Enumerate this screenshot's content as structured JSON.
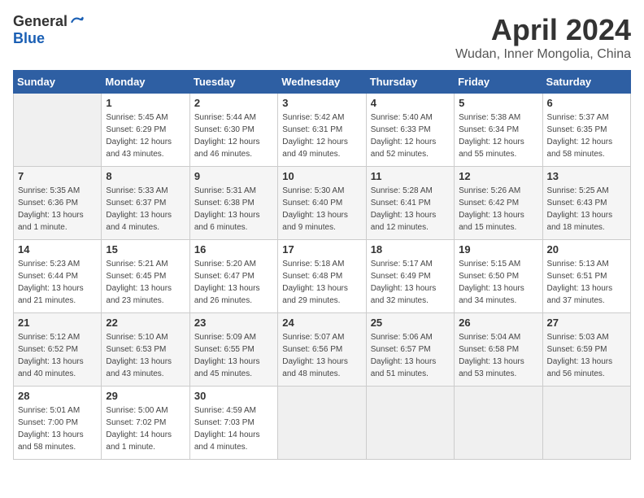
{
  "header": {
    "logo_general": "General",
    "logo_blue": "Blue",
    "month": "April 2024",
    "location": "Wudan, Inner Mongolia, China"
  },
  "days_of_week": [
    "Sunday",
    "Monday",
    "Tuesday",
    "Wednesday",
    "Thursday",
    "Friday",
    "Saturday"
  ],
  "weeks": [
    [
      {
        "day": "",
        "info": ""
      },
      {
        "day": "1",
        "info": "Sunrise: 5:45 AM\nSunset: 6:29 PM\nDaylight: 12 hours\nand 43 minutes."
      },
      {
        "day": "2",
        "info": "Sunrise: 5:44 AM\nSunset: 6:30 PM\nDaylight: 12 hours\nand 46 minutes."
      },
      {
        "day": "3",
        "info": "Sunrise: 5:42 AM\nSunset: 6:31 PM\nDaylight: 12 hours\nand 49 minutes."
      },
      {
        "day": "4",
        "info": "Sunrise: 5:40 AM\nSunset: 6:33 PM\nDaylight: 12 hours\nand 52 minutes."
      },
      {
        "day": "5",
        "info": "Sunrise: 5:38 AM\nSunset: 6:34 PM\nDaylight: 12 hours\nand 55 minutes."
      },
      {
        "day": "6",
        "info": "Sunrise: 5:37 AM\nSunset: 6:35 PM\nDaylight: 12 hours\nand 58 minutes."
      }
    ],
    [
      {
        "day": "7",
        "info": "Sunrise: 5:35 AM\nSunset: 6:36 PM\nDaylight: 13 hours\nand 1 minute."
      },
      {
        "day": "8",
        "info": "Sunrise: 5:33 AM\nSunset: 6:37 PM\nDaylight: 13 hours\nand 4 minutes."
      },
      {
        "day": "9",
        "info": "Sunrise: 5:31 AM\nSunset: 6:38 PM\nDaylight: 13 hours\nand 6 minutes."
      },
      {
        "day": "10",
        "info": "Sunrise: 5:30 AM\nSunset: 6:40 PM\nDaylight: 13 hours\nand 9 minutes."
      },
      {
        "day": "11",
        "info": "Sunrise: 5:28 AM\nSunset: 6:41 PM\nDaylight: 13 hours\nand 12 minutes."
      },
      {
        "day": "12",
        "info": "Sunrise: 5:26 AM\nSunset: 6:42 PM\nDaylight: 13 hours\nand 15 minutes."
      },
      {
        "day": "13",
        "info": "Sunrise: 5:25 AM\nSunset: 6:43 PM\nDaylight: 13 hours\nand 18 minutes."
      }
    ],
    [
      {
        "day": "14",
        "info": "Sunrise: 5:23 AM\nSunset: 6:44 PM\nDaylight: 13 hours\nand 21 minutes."
      },
      {
        "day": "15",
        "info": "Sunrise: 5:21 AM\nSunset: 6:45 PM\nDaylight: 13 hours\nand 23 minutes."
      },
      {
        "day": "16",
        "info": "Sunrise: 5:20 AM\nSunset: 6:47 PM\nDaylight: 13 hours\nand 26 minutes."
      },
      {
        "day": "17",
        "info": "Sunrise: 5:18 AM\nSunset: 6:48 PM\nDaylight: 13 hours\nand 29 minutes."
      },
      {
        "day": "18",
        "info": "Sunrise: 5:17 AM\nSunset: 6:49 PM\nDaylight: 13 hours\nand 32 minutes."
      },
      {
        "day": "19",
        "info": "Sunrise: 5:15 AM\nSunset: 6:50 PM\nDaylight: 13 hours\nand 34 minutes."
      },
      {
        "day": "20",
        "info": "Sunrise: 5:13 AM\nSunset: 6:51 PM\nDaylight: 13 hours\nand 37 minutes."
      }
    ],
    [
      {
        "day": "21",
        "info": "Sunrise: 5:12 AM\nSunset: 6:52 PM\nDaylight: 13 hours\nand 40 minutes."
      },
      {
        "day": "22",
        "info": "Sunrise: 5:10 AM\nSunset: 6:53 PM\nDaylight: 13 hours\nand 43 minutes."
      },
      {
        "day": "23",
        "info": "Sunrise: 5:09 AM\nSunset: 6:55 PM\nDaylight: 13 hours\nand 45 minutes."
      },
      {
        "day": "24",
        "info": "Sunrise: 5:07 AM\nSunset: 6:56 PM\nDaylight: 13 hours\nand 48 minutes."
      },
      {
        "day": "25",
        "info": "Sunrise: 5:06 AM\nSunset: 6:57 PM\nDaylight: 13 hours\nand 51 minutes."
      },
      {
        "day": "26",
        "info": "Sunrise: 5:04 AM\nSunset: 6:58 PM\nDaylight: 13 hours\nand 53 minutes."
      },
      {
        "day": "27",
        "info": "Sunrise: 5:03 AM\nSunset: 6:59 PM\nDaylight: 13 hours\nand 56 minutes."
      }
    ],
    [
      {
        "day": "28",
        "info": "Sunrise: 5:01 AM\nSunset: 7:00 PM\nDaylight: 13 hours\nand 58 minutes."
      },
      {
        "day": "29",
        "info": "Sunrise: 5:00 AM\nSunset: 7:02 PM\nDaylight: 14 hours\nand 1 minute."
      },
      {
        "day": "30",
        "info": "Sunrise: 4:59 AM\nSunset: 7:03 PM\nDaylight: 14 hours\nand 4 minutes."
      },
      {
        "day": "",
        "info": ""
      },
      {
        "day": "",
        "info": ""
      },
      {
        "day": "",
        "info": ""
      },
      {
        "day": "",
        "info": ""
      }
    ]
  ]
}
